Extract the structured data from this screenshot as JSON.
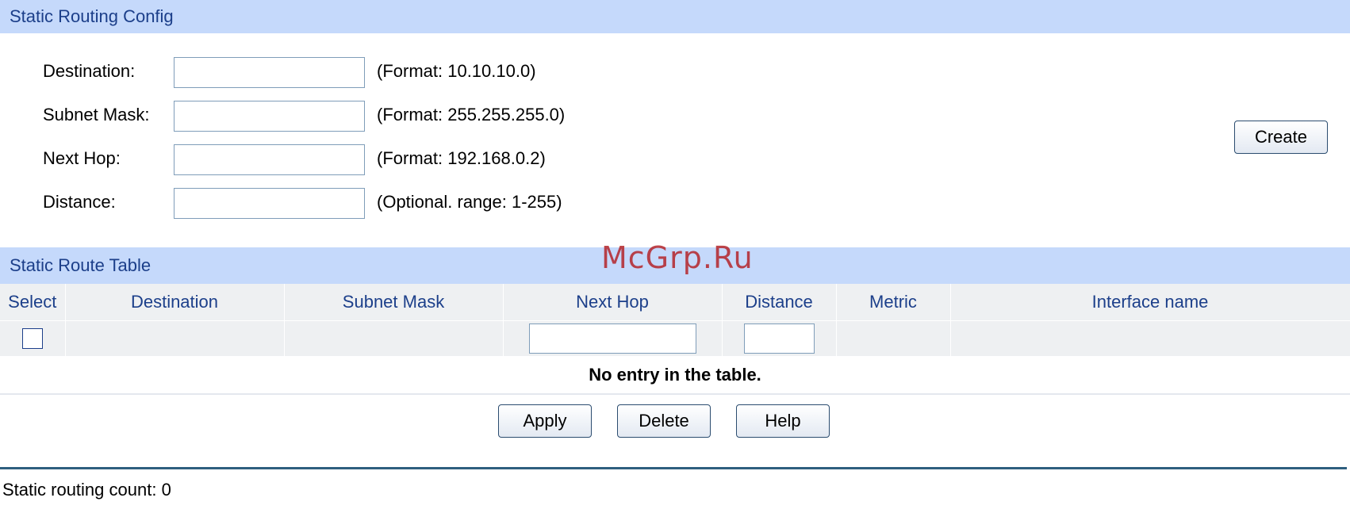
{
  "config_section": {
    "title": "Static Routing Config",
    "fields": [
      {
        "label": "Destination:",
        "value": "",
        "hint": "(Format: 10.10.10.0)"
      },
      {
        "label": "Subnet Mask:",
        "value": "",
        "hint": "(Format: 255.255.255.0)"
      },
      {
        "label": "Next Hop:",
        "value": "",
        "hint": "(Format: 192.168.0.2)"
      },
      {
        "label": "Distance:",
        "value": "",
        "hint": "(Optional. range: 1-255)"
      }
    ],
    "create_label": "Create"
  },
  "table_section": {
    "title": "Static Route Table",
    "columns": [
      "Select",
      "Destination",
      "Subnet Mask",
      "Next Hop",
      "Distance",
      "Metric",
      "Interface name"
    ],
    "filter_next_hop_value": "",
    "filter_distance_value": "",
    "select_checked": false,
    "empty_message": "No entry in the table."
  },
  "actions": {
    "apply_label": "Apply",
    "delete_label": "Delete",
    "help_label": "Help"
  },
  "footer": {
    "count_label": "Static routing count:",
    "count_value": "0"
  },
  "watermark": "McGrp.Ru",
  "colors": {
    "header_bg": "#c5d9fb",
    "header_text": "#1c3f8a",
    "table_bg": "#eef0f2",
    "divider": "#2e5f7f",
    "watermark": "#b4252a"
  }
}
